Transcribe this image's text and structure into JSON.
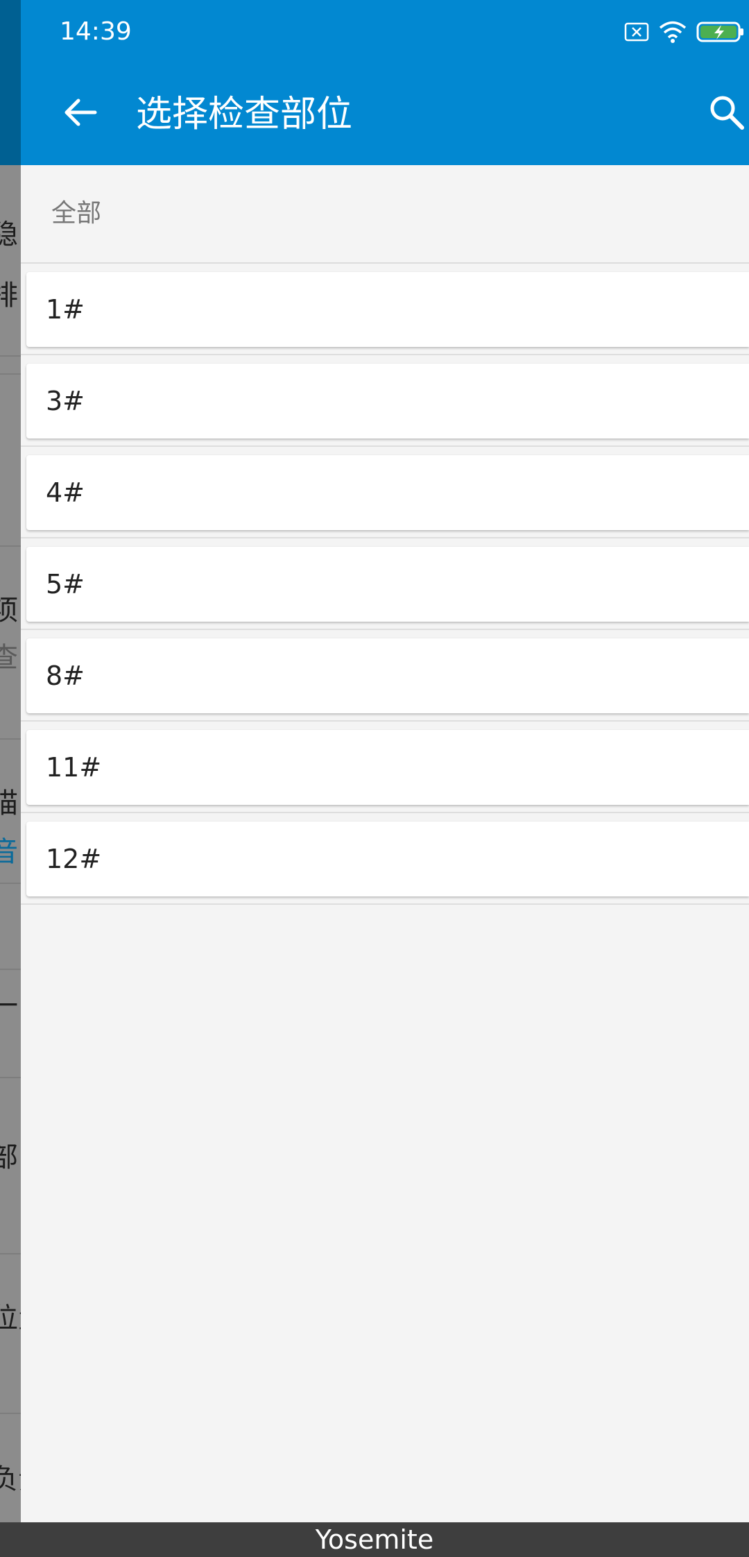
{
  "status_bar": {
    "time": "14:39",
    "icons": [
      "sim-off-icon",
      "wifi-icon",
      "battery-charging-icon"
    ]
  },
  "app_bar": {
    "title": "选择检查部位",
    "back_icon": "arrow-left-icon",
    "search_icon": "search-icon",
    "color": "#0288d1"
  },
  "list": {
    "header_label": "全部",
    "items": [
      {
        "label": "1#"
      },
      {
        "label": "3#"
      },
      {
        "label": "4#"
      },
      {
        "label": "5#"
      },
      {
        "label": "8#"
      },
      {
        "label": "11#"
      },
      {
        "label": "12#"
      }
    ]
  },
  "background_fragments": [
    "隐",
    "排",
    "项",
    "查",
    "描",
    "音",
    "一",
    "部",
    "位置",
    "负责"
  ],
  "footer": {
    "label": "Yosemite"
  }
}
